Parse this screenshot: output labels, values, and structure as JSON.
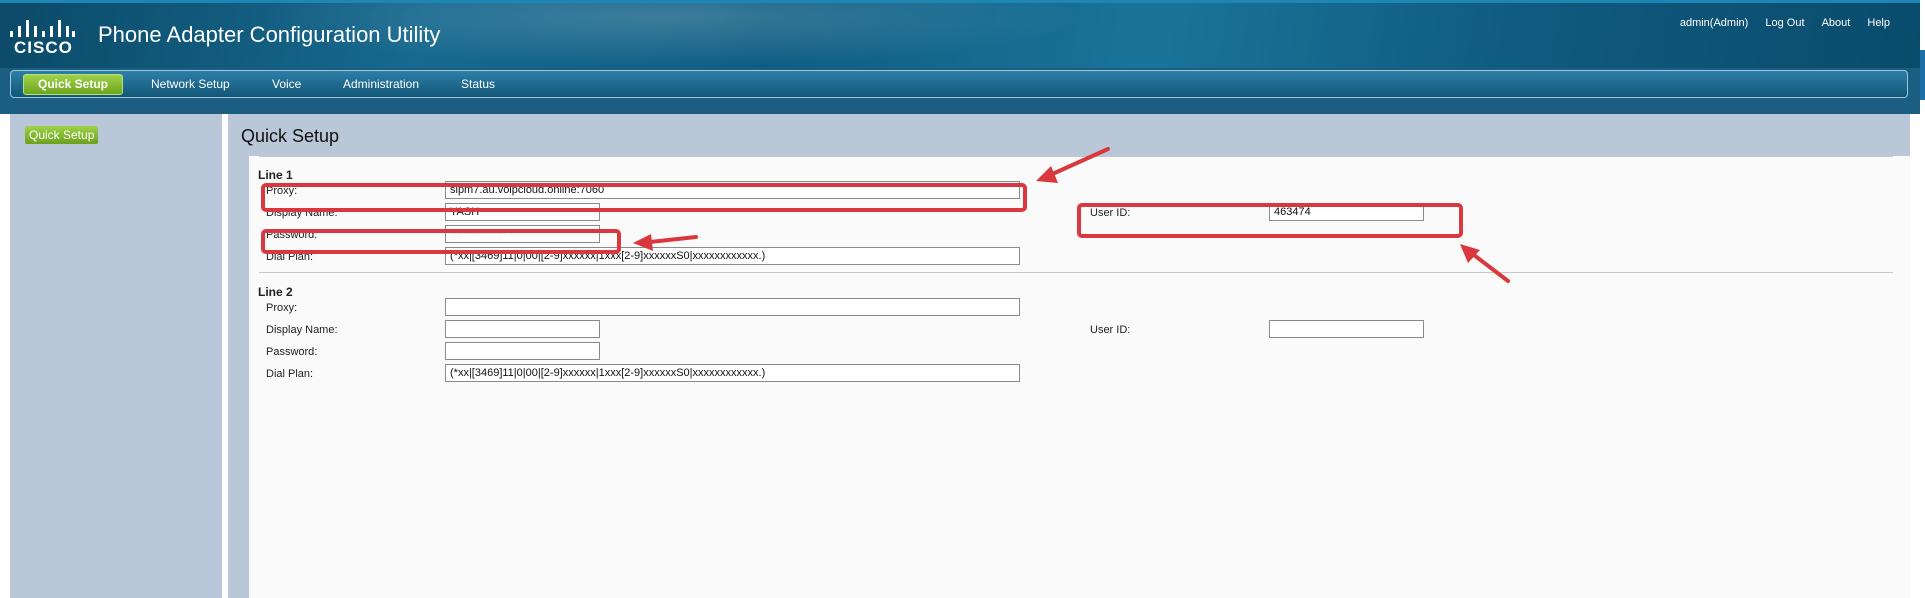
{
  "header": {
    "logo_text": "CISCO",
    "app_title": "Phone Adapter Configuration Utility",
    "user": "admin(Admin)",
    "logout": "Log Out",
    "about": "About",
    "help": "Help"
  },
  "nav": {
    "tabs": [
      {
        "label": "Quick Setup",
        "active": true
      },
      {
        "label": "Network Setup"
      },
      {
        "label": "Voice"
      },
      {
        "label": "Administration"
      },
      {
        "label": "Status"
      }
    ]
  },
  "sidebar": {
    "items": [
      {
        "label": "Quick Setup"
      }
    ]
  },
  "page": {
    "title": "Quick Setup"
  },
  "line1": {
    "title": "Line 1",
    "proxy_label": "Proxy:",
    "proxy": "sipm7.au.voipcloud.online:7060",
    "display_name_label": "Display Name:",
    "display_name": "YASH",
    "password_label": "Password:",
    "password": "*************",
    "user_id_label": "User ID:",
    "user_id": "463474",
    "dial_plan_label": "Dial Plan:",
    "dial_plan": "(*xx|[3469]11|0|00|[2-9]xxxxxx|1xxx[2-9]xxxxxxS0|xxxxxxxxxxxx.)"
  },
  "line2": {
    "title": "Line 2",
    "proxy_label": "Proxy:",
    "proxy": "",
    "display_name_label": "Display Name:",
    "display_name": "",
    "password_label": "Password:",
    "password": "",
    "user_id_label": "User ID:",
    "user_id": "",
    "dial_plan_label": "Dial Plan:",
    "dial_plan": "(*xx|[3469]11|0|00|[2-9]xxxxxx|1xxx[2-9]xxxxxxS0|xxxxxxxxxxxx.)"
  },
  "colors": {
    "header_blue": "#0f5d82",
    "active_green": "#7ab62a",
    "annotation_red": "#d9383e",
    "panel_bg": "#b9c7d9"
  }
}
